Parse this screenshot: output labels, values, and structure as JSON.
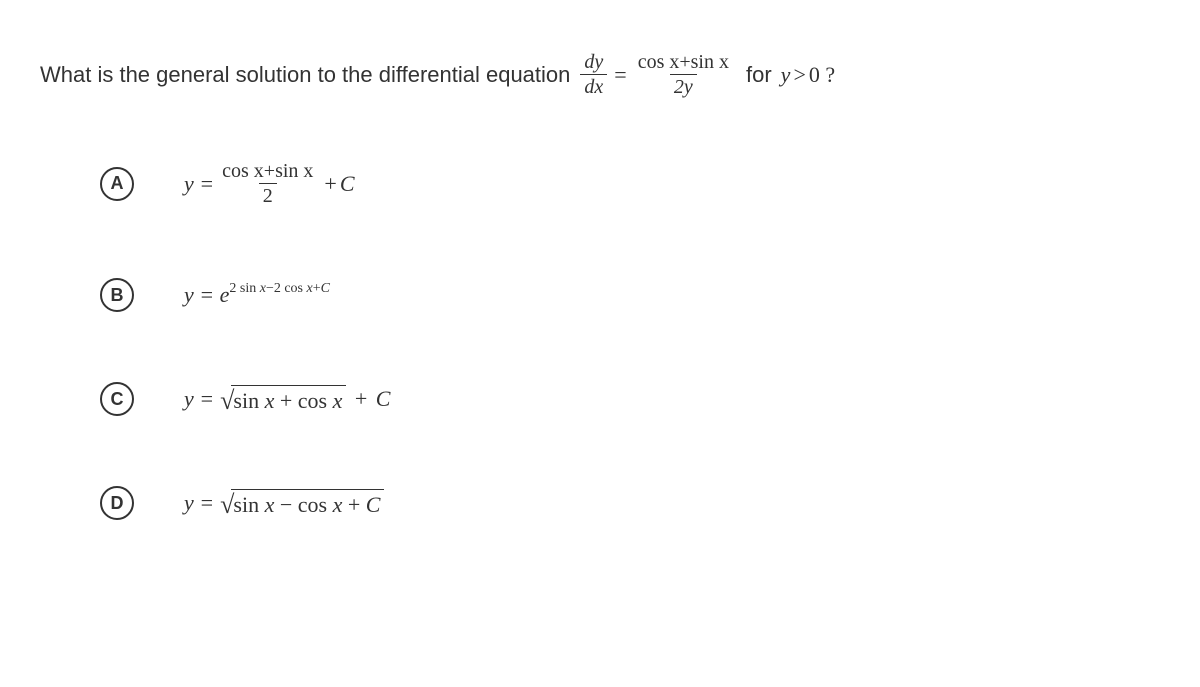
{
  "question": {
    "part1": "What is the general solution to the differential equation",
    "fracLeftNum": "dy",
    "fracLeftDen": "dx",
    "equals": "=",
    "fracRightNum": "cos x+sin x",
    "fracRightDen": "2y",
    "part2": "for",
    "cond": "y > 0 ?"
  },
  "options": {
    "A": {
      "letter": "A",
      "prefix": "y =",
      "fracNum": "cos x+sin x",
      "fracDen": "2",
      "suffix": "+ C"
    },
    "B": {
      "letter": "B",
      "prefix": "y = e",
      "exponent": "2 sin x−2 cos x+C"
    },
    "C": {
      "letter": "C",
      "prefix": "y =",
      "radicand": "sin x + cos x",
      "suffix": "+ C"
    },
    "D": {
      "letter": "D",
      "prefix": "y =",
      "radicand": "sin x − cos x + C"
    }
  }
}
